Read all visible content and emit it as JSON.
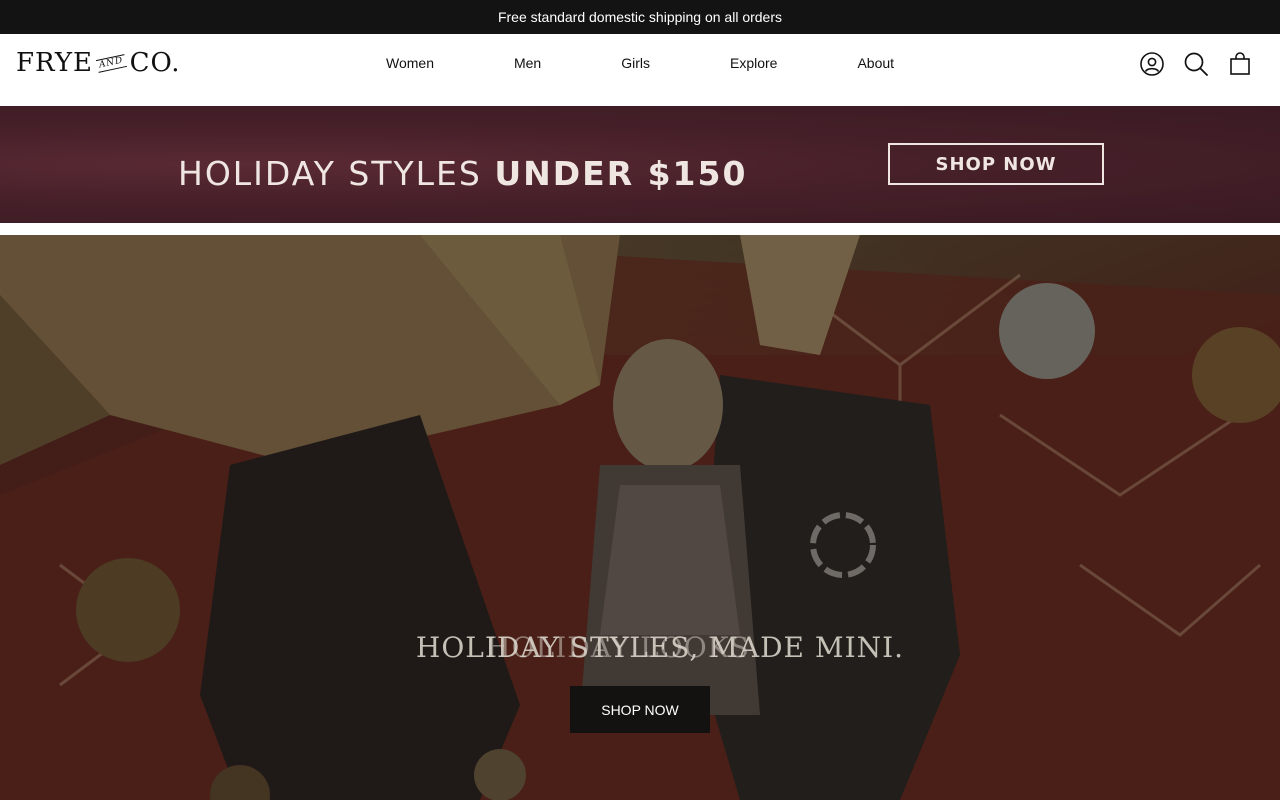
{
  "announcement": {
    "text": "Free standard domestic shipping on all orders"
  },
  "header": {
    "logo": {
      "left": "FRYE",
      "and": "AND",
      "right": "CO."
    },
    "nav": [
      {
        "label": "Women"
      },
      {
        "label": "Men"
      },
      {
        "label": "Girls"
      },
      {
        "label": "Explore"
      },
      {
        "label": "About"
      }
    ],
    "icons": [
      "account-icon",
      "search-icon",
      "cart-icon"
    ]
  },
  "promo_banner": {
    "text_regular": "HOLIDAY STYLES",
    "text_bold": "UNDER $150",
    "button_label": "SHOP NOW"
  },
  "hero": {
    "title_primary": "HOLIDAY STYLES, MADE MINI.",
    "title_secondary": "HOLIDAY LOOKS",
    "button_label": "SHOP NOW"
  },
  "colors": {
    "announcement_bg": "#131313",
    "promo_bg": "#472029",
    "hero_button_bg": "#141210"
  }
}
